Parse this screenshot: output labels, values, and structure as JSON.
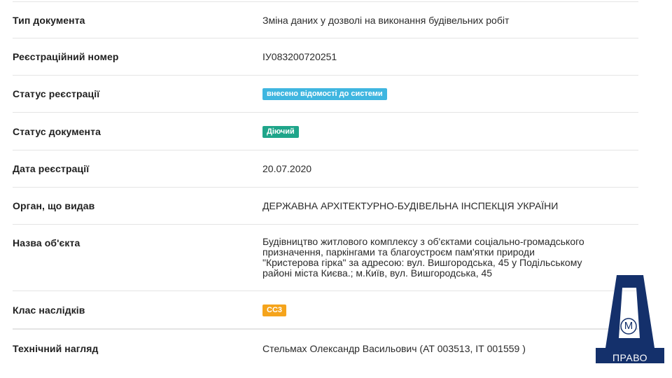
{
  "fields": [
    {
      "label": "Тип документа",
      "value": "Зміна даних у дозволі на виконання будівельних робіт"
    },
    {
      "label": "Реєстраційний номер",
      "value": "IУ083200720251"
    },
    {
      "label": "Статус реєстрації",
      "badge": "внесено відомості до системи",
      "badge_color": "#3fb6e0"
    },
    {
      "label": "Статус документа",
      "badge": "Діючий",
      "badge_color": "#1fa58a"
    },
    {
      "label": "Дата реєстрації",
      "value": "20.07.2020"
    },
    {
      "label": "Орган, що видав",
      "value": "ДЕРЖАВНА АРХІТЕКТУРНО-БУДІВЕЛЬНА ІНСПЕКЦІЯ УКРАЇНИ"
    },
    {
      "label": "Назва об'єкта",
      "value_lines": [
        "Будівництво житлового комплексу з об'єктами соціально-громадського",
        "призначення, паркінгами та благоустроєм пам'ятки природи",
        "\"Кристерова гірка\" за адресою: вул. Вишгородська, 45 у Подільському",
        "районі міста Києва.; м.Київ, вул. Вишгородська, 45"
      ]
    },
    {
      "label": "Клас наслідків",
      "badge": "СС3",
      "badge_color": "#f5a41c"
    },
    {
      "label": "Технічний нагляд",
      "value": "Стельмах Олександр Васильович (АТ 003513, IТ 001559 )"
    }
  ],
  "logo": {
    "letter": "М",
    "caption": "ПРАВО",
    "color": "#14306b"
  }
}
